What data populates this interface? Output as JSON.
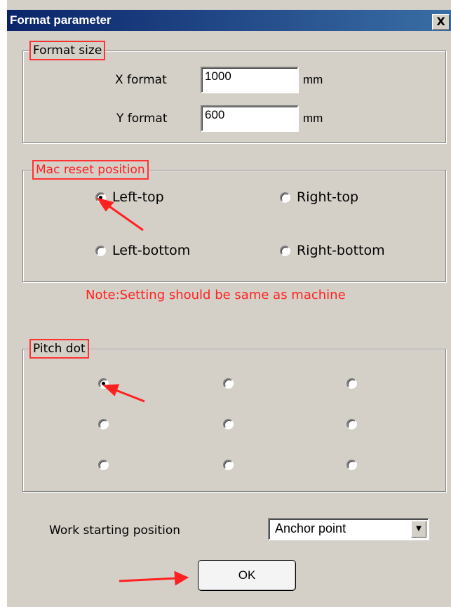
{
  "dialog": {
    "title": "Format parameter",
    "close_label": "X"
  },
  "format_size": {
    "legend": "Format size",
    "x_label": "X format",
    "x_value": "1000",
    "x_unit": "mm",
    "y_label": "Y format",
    "y_value": "600",
    "y_unit": "mm"
  },
  "reset": {
    "legend": "Mac reset position",
    "options": [
      "Left-top",
      "Right-top",
      "Left-bottom",
      "Right-bottom"
    ],
    "selected": "Left-top"
  },
  "note": "Note:Setting should be same as machine",
  "pitch": {
    "legend": "Pitch dot",
    "selected_index": 0
  },
  "work": {
    "label": "Work starting position",
    "value": "Anchor point"
  },
  "ok_label": "OK",
  "colors": {
    "annotation": "#ff2020",
    "title_bar": "#0a246a",
    "face": "#d4d0c8"
  }
}
